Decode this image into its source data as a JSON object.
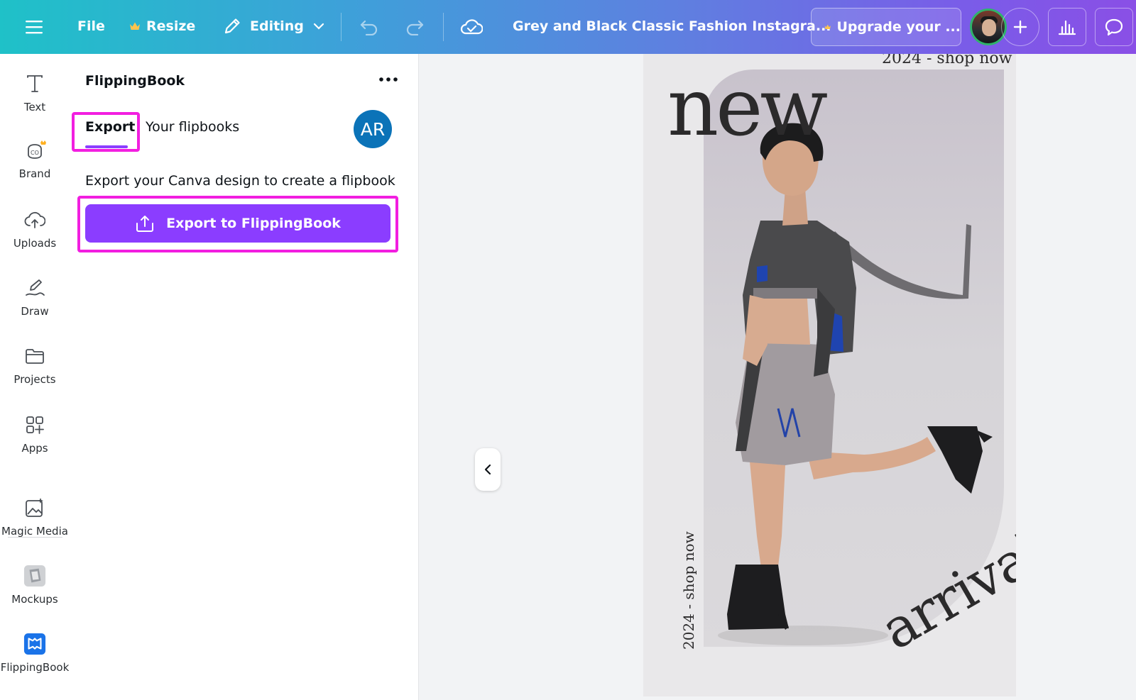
{
  "topbar": {
    "file_label": "File",
    "resize_label": "Resize",
    "editing_label": "Editing",
    "doc_title": "Grey and Black Classic Fashion Instagra...",
    "upgrade_label": "Upgrade your ...",
    "accent_color": "#8b3dff"
  },
  "rail": {
    "items": [
      {
        "label": "Text",
        "icon": "text-icon"
      },
      {
        "label": "Brand",
        "icon": "brand-icon"
      },
      {
        "label": "Uploads",
        "icon": "cloud-upload-icon"
      },
      {
        "label": "Draw",
        "icon": "draw-icon"
      },
      {
        "label": "Projects",
        "icon": "folder-icon"
      },
      {
        "label": "Apps",
        "icon": "apps-icon"
      },
      {
        "label": "Magic Media",
        "icon": "magic-media-icon"
      },
      {
        "label": "Mockups",
        "icon": "mockups-icon"
      },
      {
        "label": "FlippingBook",
        "icon": "flippingbook-icon"
      }
    ]
  },
  "panel": {
    "title": "FlippingBook",
    "tabs": [
      {
        "label": "Export",
        "active": true
      },
      {
        "label": "Your flipbooks",
        "active": false
      }
    ],
    "avatar_initials": "AR",
    "description": "Export your Canva design to create a flipbook",
    "export_button": "Export to FlippingBook",
    "highlight_color": "#f21ee0"
  },
  "canvas": {
    "headline": "new",
    "subline_top": "2024 - shop now",
    "subline_side": "2024 - shop now",
    "tagline": "arrival"
  }
}
